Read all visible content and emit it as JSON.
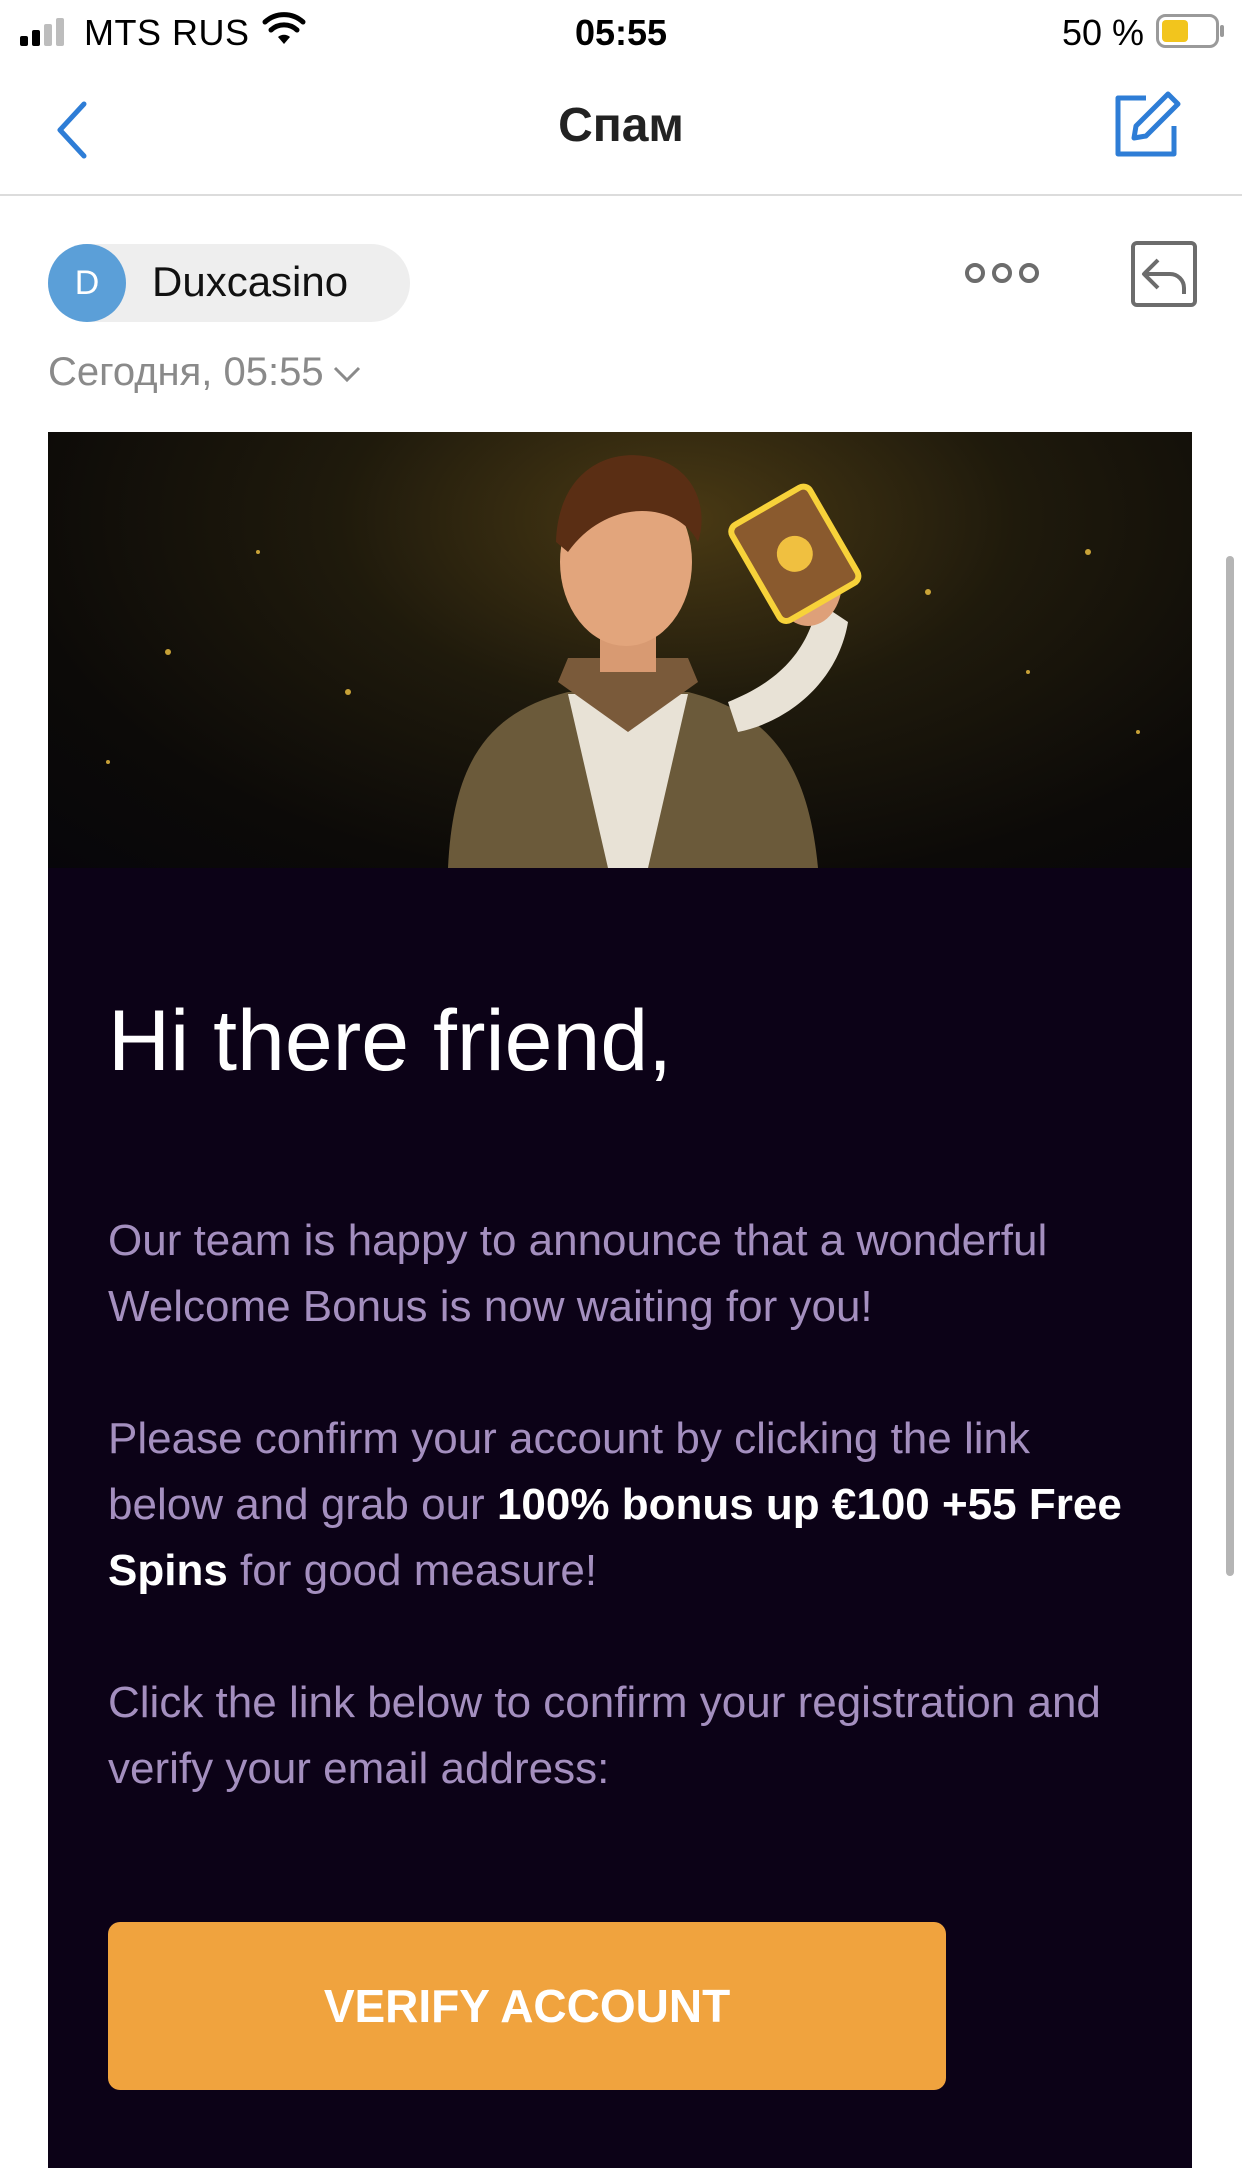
{
  "status_bar": {
    "carrier": "MTS RUS",
    "time": "05:55",
    "battery_percent": "50 %",
    "battery_level": 0.5,
    "battery_color": "#f2c51d"
  },
  "nav": {
    "title": "Спам",
    "back_icon": "chevron-left-icon",
    "compose_icon": "compose-icon",
    "accent_color": "#2e7dd6"
  },
  "message": {
    "sender_initial": "D",
    "sender_name": "Duxcasino",
    "date": "Сегодня, 05:55",
    "more_icon": "more-dots-icon",
    "reply_icon": "reply-icon"
  },
  "email": {
    "greeting": "Hi there friend,",
    "para1": "Our team is happy to announce that a wonderful Welcome Bonus is now waiting for you!",
    "para2_start": "Please confirm your account by clicking the link below and grab our ",
    "para2_bold": "100% bonus up €100 +55 Free Spins",
    "para2_end": " for good measure!",
    "para3": "Click the link below to confirm your registration and verify your email address:",
    "button_label": "VERIFY ACCOUNT",
    "button_color": "#f0a33e",
    "background_color": "#0c0217"
  }
}
